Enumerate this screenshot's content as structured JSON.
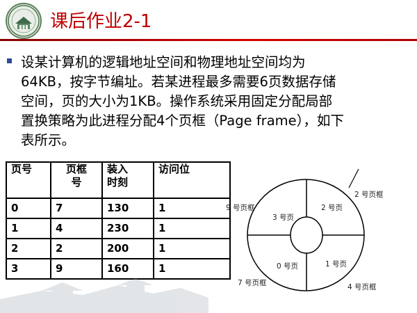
{
  "header": {
    "title": "课后作业2-1"
  },
  "paragraph": {
    "lines": [
      "设某计算机的逻辑地址空间和物理地址空间均为",
      "64KB，按字节编址。若某进程最多需要6页数据存储",
      "空间，页的大小为1KB。操作系统采用固定分配局部",
      "置换策略为此进程分配4个页框（Page frame），如下",
      "表所示。"
    ]
  },
  "table": {
    "headers": [
      [
        "页号"
      ],
      [
        "页框",
        "号"
      ],
      [
        "装入",
        "时刻"
      ],
      [
        "访问位"
      ]
    ],
    "rows": [
      [
        "0",
        "7",
        "130",
        "1"
      ],
      [
        "1",
        "4",
        "230",
        "1"
      ],
      [
        "2",
        "2",
        "200",
        "1"
      ],
      [
        "3",
        "9",
        "160",
        "1"
      ]
    ]
  },
  "diagram": {
    "labels": {
      "inner_top_left": "3 号页",
      "inner_top_right": "2 号页",
      "inner_bottom_left": "0 号页",
      "inner_bottom_right": "1 号页",
      "outer_top_left": "9 号页框",
      "outer_top_right": "2 号页框",
      "outer_bottom_left": "7 号页框",
      "outer_bottom_right": "4 号页框"
    }
  },
  "colors": {
    "title": "#c00000",
    "rule": "#c00000",
    "bullet": "#2a4a9a"
  }
}
